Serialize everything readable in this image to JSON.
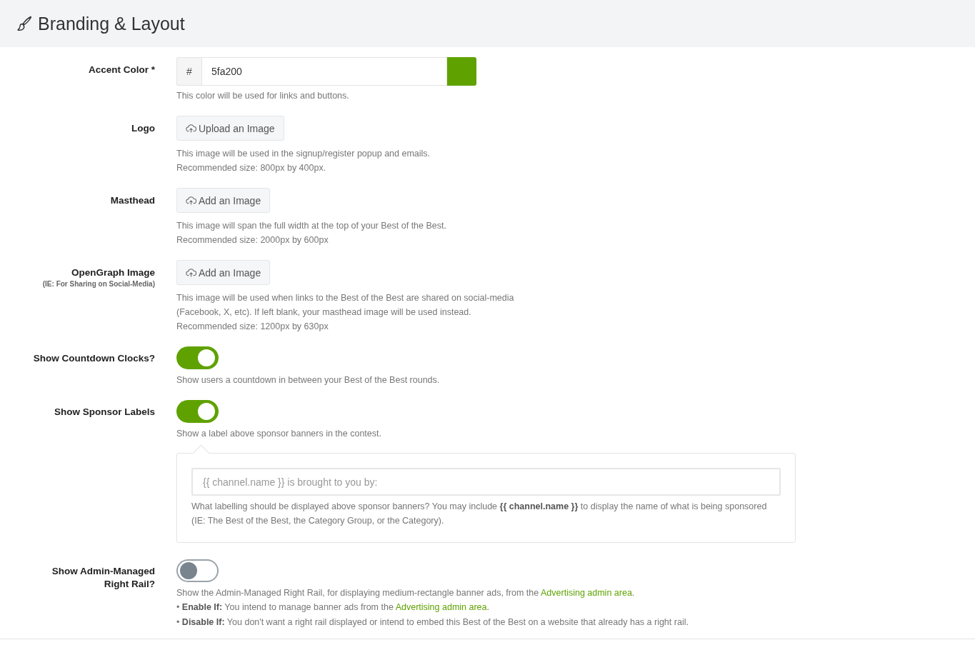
{
  "header": {
    "title": "Branding & Layout"
  },
  "fields": [
    {
      "kind": "color",
      "label": "Accent Color *",
      "prefix": "#",
      "value": "5fa200",
      "help": [
        {
          "parts": [
            {
              "kind": "text",
              "text": "This color will be used for links and buttons."
            }
          ]
        }
      ]
    },
    {
      "kind": "upload",
      "label": "Logo",
      "button": "Upload an Image",
      "help": [
        {
          "parts": [
            {
              "kind": "text",
              "text": "This image will be used in the signup/register popup and emails."
            }
          ]
        },
        {
          "parts": [
            {
              "kind": "text",
              "text": "Recommended size: 800px by 400px."
            }
          ]
        }
      ]
    },
    {
      "kind": "upload",
      "label": "Masthead",
      "button": "Add an Image",
      "help": [
        {
          "parts": [
            {
              "kind": "text",
              "text": "This image will span the full width at the top of your Best of the Best."
            }
          ]
        },
        {
          "parts": [
            {
              "kind": "text",
              "text": "Recommended size: 2000px by 600px"
            }
          ]
        }
      ]
    },
    {
      "kind": "upload",
      "label": "OpenGraph Image",
      "sublabel": "(IE: For Sharing on Social-Media)",
      "button": "Add an Image",
      "help": [
        {
          "parts": [
            {
              "kind": "text",
              "text": "This image will be used when links to the Best of the Best are shared on social-media"
            }
          ]
        },
        {
          "parts": [
            {
              "kind": "text",
              "text": "(Facebook, X, etc). If left blank, your masthead image will be used instead."
            }
          ]
        },
        {
          "parts": [
            {
              "kind": "text",
              "text": "Recommended size: 1200px by 630px"
            }
          ]
        }
      ]
    },
    {
      "kind": "toggle",
      "label": "Show Countdown Clocks?",
      "on": true,
      "help": [
        {
          "parts": [
            {
              "kind": "text",
              "text": "Show users a countdown in between your Best of the Best rounds."
            }
          ]
        }
      ]
    },
    {
      "kind": "toggle",
      "label": "Show Sponsor Labels",
      "on": true,
      "help": [
        {
          "parts": [
            {
              "kind": "text",
              "text": "Show a label above sponsor banners in the contest."
            }
          ]
        }
      ],
      "panel": {
        "placeholder": "{{ channel.name }} is brought to you by:",
        "help": "What labelling should be displayed above sponsor banners? You may include **{{ channel.name }}** to display the name of what is being sponsored (IE: The Best of the Best, the Category Group, or the Category)."
      }
    },
    {
      "kind": "toggle",
      "label": "Show Admin-Managed Right Rail?",
      "on": false,
      "help": [
        {
          "parts": [
            {
              "kind": "text",
              "text": "Show the Admin-Managed Right Rail, for displaying medium-rectangle banner ads, from the "
            },
            {
              "kind": "link",
              "text": "Advertising admin area"
            },
            {
              "kind": "text",
              "text": "."
            }
          ]
        },
        {
          "parts": [
            {
              "kind": "text",
              "text": "• **Enable If:** You intend to manage banner ads from the "
            },
            {
              "kind": "link",
              "text": "Advertising admin area"
            },
            {
              "kind": "text",
              "text": "."
            }
          ]
        },
        {
          "parts": [
            {
              "kind": "text",
              "text": "• **Disable If:** You don't want a right rail displayed or intend to embed this Best of the Best on a website that already has a right rail."
            }
          ]
        }
      ]
    }
  ]
}
